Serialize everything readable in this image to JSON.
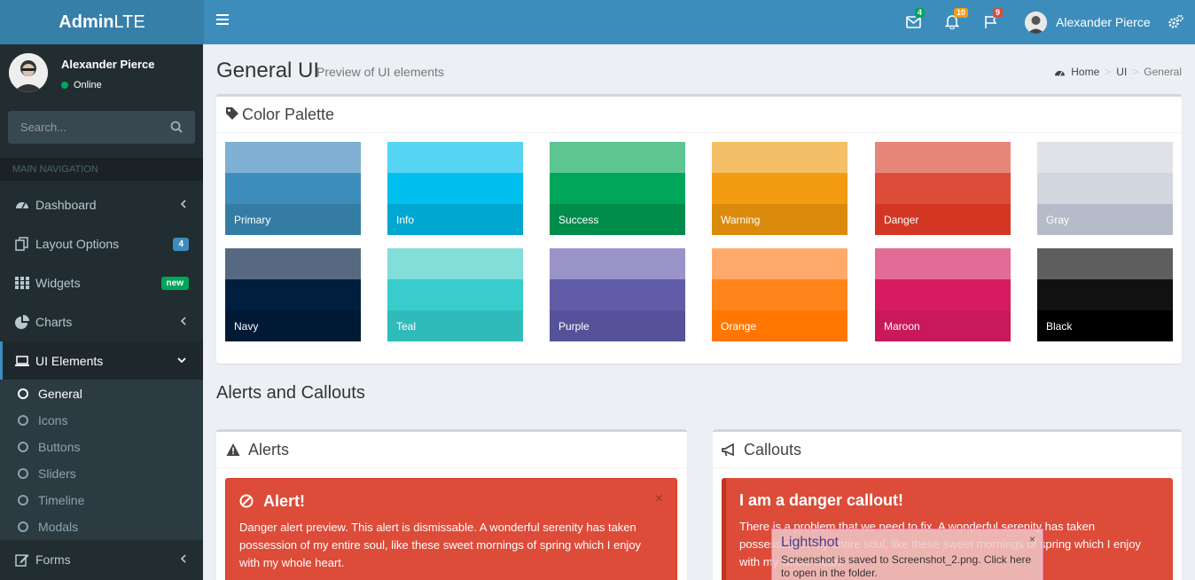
{
  "app": {
    "logo_bold": "Admin",
    "logo_rest": "LTE"
  },
  "topnav": {
    "messages_count": "4",
    "notifications_count": "10",
    "tasks_count": "9",
    "user_name": "Alexander Pierce",
    "colors": {
      "messages": "#00a65a",
      "notifications": "#f39c12",
      "tasks": "#dd4b39"
    }
  },
  "sidebar": {
    "user_name": "Alexander Pierce",
    "status": "Online",
    "search_placeholder": "Search...",
    "header": "MAIN NAVIGATION",
    "items": [
      {
        "label": "Dashboard",
        "icon": "dashboard-icon"
      },
      {
        "label": "Layout Options",
        "icon": "files-icon",
        "badge": "4"
      },
      {
        "label": "Widgets",
        "icon": "th-icon",
        "badge": "new"
      },
      {
        "label": "Charts",
        "icon": "pie-chart-icon"
      },
      {
        "label": "UI Elements",
        "icon": "laptop-icon"
      },
      {
        "label": "Forms",
        "icon": "edit-icon"
      }
    ],
    "subitems": [
      "General",
      "Icons",
      "Buttons",
      "Sliders",
      "Timeline",
      "Modals"
    ]
  },
  "page": {
    "title": "General UI",
    "subtitle": "Preview of UI elements",
    "breadcrumb": [
      "Home",
      "UI",
      "General"
    ]
  },
  "palette": {
    "title": "Color Palette",
    "swatches": [
      {
        "label": "Primary",
        "colors": [
          "#7fb0d3",
          "#3c8dbc",
          "#357ca5"
        ]
      },
      {
        "label": "Info",
        "colors": [
          "#56d5f2",
          "#00c0ef",
          "#00a7d0"
        ]
      },
      {
        "label": "Success",
        "colors": [
          "#5cc591",
          "#00a65a",
          "#008d4c"
        ]
      },
      {
        "label": "Warning",
        "colors": [
          "#f5bf68",
          "#f39c12",
          "#db8b0b"
        ]
      },
      {
        "label": "Danger",
        "colors": [
          "#e6867a",
          "#dd4b39",
          "#d33724"
        ]
      },
      {
        "label": "Gray",
        "colors": [
          "#e0e2e7",
          "#d2d6de",
          "#b5bbc8"
        ]
      },
      {
        "label": "Navy",
        "colors": [
          "#576981",
          "#001f3f",
          "#001a35"
        ]
      },
      {
        "label": "Teal",
        "colors": [
          "#82ded9",
          "#39cccc",
          "#30bbbb"
        ]
      },
      {
        "label": "Purple",
        "colors": [
          "#9a93c7",
          "#605ca8",
          "#555299"
        ]
      },
      {
        "label": "Orange",
        "colors": [
          "#ffaa6a",
          "#ff851b",
          "#ff7701"
        ]
      },
      {
        "label": "Maroon",
        "colors": [
          "#e26c96",
          "#d81b60",
          "#ca195a"
        ]
      },
      {
        "label": "Black",
        "colors": [
          "#5e5e5e",
          "#111111",
          "#000000"
        ]
      }
    ]
  },
  "section_title": "Alerts and Callouts",
  "alerts": {
    "title": "Alerts",
    "alert_title": "Alert!",
    "close": "×",
    "alert_text": "Danger alert preview. This alert is dismissable. A wonderful serenity has taken possession of my entire soul, like these sweet mornings of spring which I enjoy with my whole heart."
  },
  "callouts": {
    "title": "Callouts",
    "callout_title": "I am a danger callout!",
    "callout_text": "There is a problem that we need to fix. A wonderful serenity has taken possession of my entire soul, like these sweet mornings of spring which I enjoy with my whole heart."
  },
  "toast": {
    "title": "Lightshot",
    "message": "Screenshot is saved to Screenshot_2.png. Click here to open in the folder.",
    "close": "×"
  }
}
